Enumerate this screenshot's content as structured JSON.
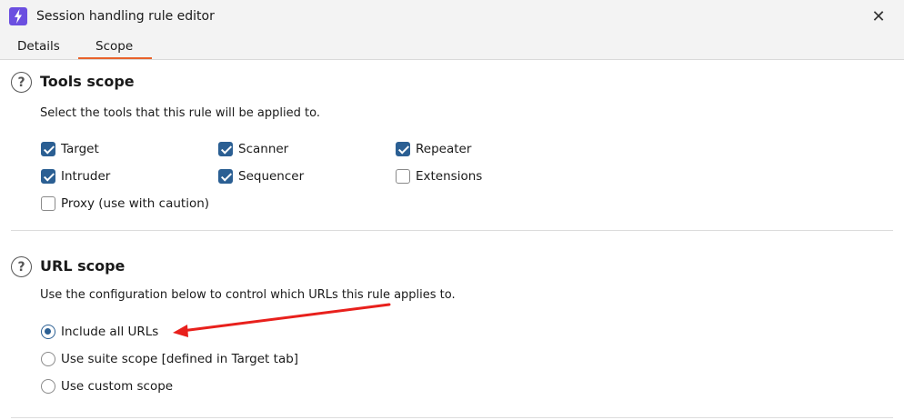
{
  "window": {
    "title": "Session handling rule editor",
    "close_label": "✕"
  },
  "tabs": [
    {
      "label": "Details"
    },
    {
      "label": "Scope",
      "active": true
    }
  ],
  "accent_color": "#e8622a",
  "checked_color": "#2b5f93",
  "tools_scope": {
    "title": "Tools scope",
    "description": "Select the tools that this rule will be applied to.",
    "options": [
      {
        "label": "Target",
        "checked": true
      },
      {
        "label": "Scanner",
        "checked": true
      },
      {
        "label": "Repeater",
        "checked": true
      },
      {
        "label": "Intruder",
        "checked": true
      },
      {
        "label": "Sequencer",
        "checked": true
      },
      {
        "label": "Extensions",
        "checked": false
      },
      {
        "label": "Proxy (use with caution)",
        "checked": false
      }
    ]
  },
  "url_scope": {
    "title": "URL scope",
    "description": "Use the configuration below to control which URLs this rule applies to.",
    "options": [
      {
        "label": "Include all URLs",
        "selected": true
      },
      {
        "label": "Use suite scope [defined in Target tab]",
        "selected": false
      },
      {
        "label": "Use custom scope",
        "selected": false
      }
    ]
  },
  "annotation_color": "#e8201c"
}
